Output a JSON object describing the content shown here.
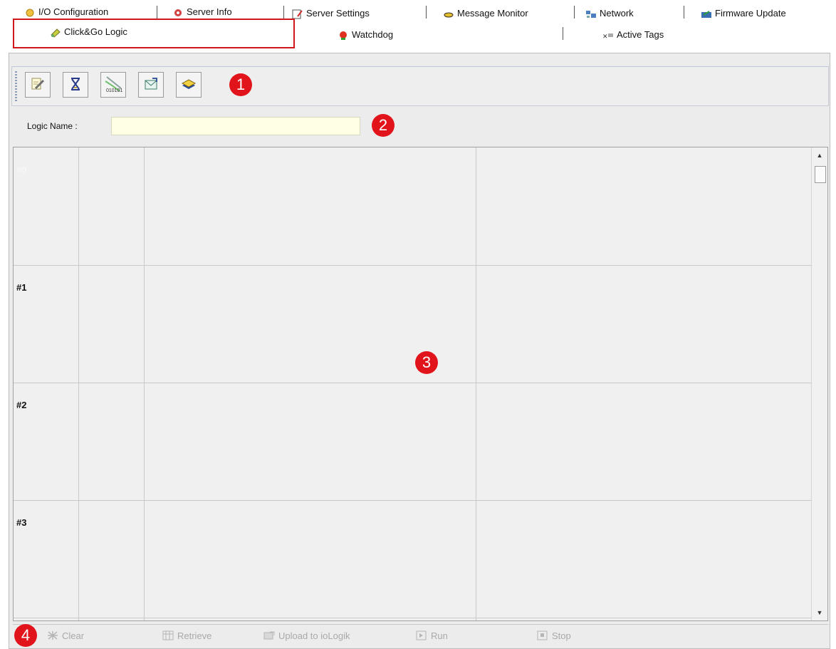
{
  "tabs": {
    "row1": [
      {
        "label": "I/O Configuration",
        "icon": "io-config-icon"
      },
      {
        "label": "Server Info",
        "icon": "server-info-icon"
      },
      {
        "label": "Server Settings",
        "icon": "server-settings-icon"
      },
      {
        "label": "Message Monitor",
        "icon": "message-monitor-icon"
      },
      {
        "label": "Network",
        "icon": "network-icon"
      },
      {
        "label": "Firmware Update",
        "icon": "firmware-update-icon"
      }
    ],
    "row2": [
      {
        "label": "Click&Go Logic",
        "icon": "logic-icon",
        "selected": true
      },
      {
        "label": "Watchdog",
        "icon": "watchdog-icon"
      },
      {
        "label": "Active Tags",
        "icon": "active-tags-icon"
      }
    ]
  },
  "callouts": [
    "1",
    "2",
    "3",
    "4"
  ],
  "toolbar": {
    "buttons": [
      {
        "icon": "edit-icon"
      },
      {
        "icon": "hourglass-icon"
      },
      {
        "icon": "binary-signal-icon",
        "text": "010101"
      },
      {
        "icon": "envelope-icon"
      },
      {
        "icon": "hardware-module-icon"
      }
    ]
  },
  "logic": {
    "label": "Logic Name :",
    "value": ""
  },
  "grid": {
    "rows": [
      "#0",
      "#1",
      "#2",
      "#3"
    ]
  },
  "bottom_bar": {
    "buttons": [
      {
        "label": "Clear",
        "icon": "clear-icon",
        "enabled": false
      },
      {
        "label": "Retrieve",
        "icon": "retrieve-icon",
        "enabled": false
      },
      {
        "label": "Upload to ioLogik",
        "icon": "upload-icon",
        "enabled": false
      },
      {
        "label": "Run",
        "icon": "run-icon",
        "enabled": false
      },
      {
        "label": "Stop",
        "icon": "stop-icon",
        "enabled": false
      }
    ]
  },
  "colors": {
    "callout_red": "#e2141b",
    "highlight_red": "#d0161b",
    "logic_input_bg": "#ffffe6"
  }
}
